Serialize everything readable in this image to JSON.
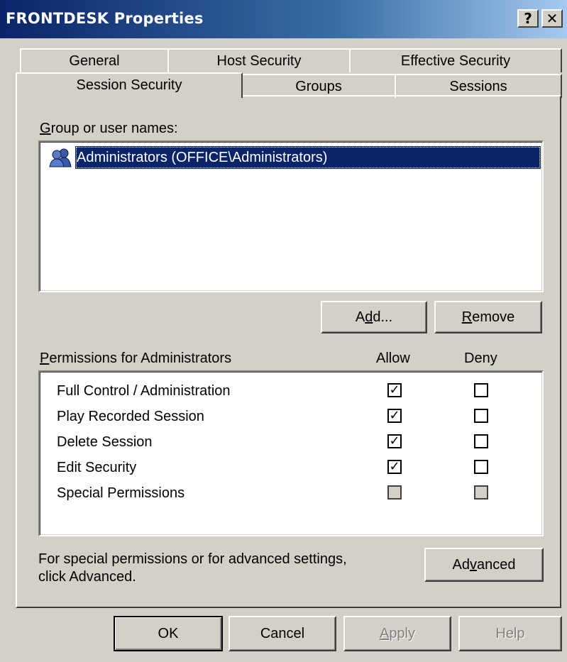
{
  "window": {
    "title": "FRONTDESK Properties",
    "help_glyph": "?",
    "close_glyph": "✕"
  },
  "tabs": {
    "row1": [
      "General",
      "Host Security",
      "Effective Security"
    ],
    "row2": [
      "Session Security",
      "Groups",
      "Sessions"
    ],
    "active": "Session Security"
  },
  "group_section": {
    "label_mnemonic": "G",
    "label_rest": "roup or user names:",
    "users": [
      {
        "icon": "user-group-icon",
        "name": "Administrators (OFFICE\\Administrators)",
        "selected": true
      }
    ]
  },
  "buttons": {
    "add_pre": "A",
    "add_mnemonic": "d",
    "add_post": "d...",
    "remove_mnemonic": "R",
    "remove_rest": "emove",
    "advanced_pre": "Ad",
    "advanced_mnemonic": "v",
    "advanced_post": "anced",
    "ok": "OK",
    "cancel": "Cancel",
    "apply_mnemonic": "A",
    "apply_rest": "pply",
    "help": "Help"
  },
  "permissions": {
    "label_mnemonic": "P",
    "label_rest": "ermissions for Administrators",
    "allow_header": "Allow",
    "deny_header": "Deny",
    "check_glyph": "✓",
    "rows": [
      {
        "name": "Full Control / Administration",
        "allow": true,
        "deny": false,
        "enabled": true
      },
      {
        "name": "Play Recorded Session",
        "allow": true,
        "deny": false,
        "enabled": true
      },
      {
        "name": "Delete Session",
        "allow": true,
        "deny": false,
        "enabled": true
      },
      {
        "name": "Edit Security",
        "allow": true,
        "deny": false,
        "enabled": true
      },
      {
        "name": "Special Permissions",
        "allow": false,
        "deny": false,
        "enabled": false
      }
    ]
  },
  "advanced_note": {
    "line1": "For special permissions or for advanced settings,",
    "line2": "click Advanced."
  },
  "colors": {
    "face": "#d4d0c8",
    "selection": "#0a246a",
    "title_start": "#0a246a",
    "title_end": "#a6caf0"
  }
}
